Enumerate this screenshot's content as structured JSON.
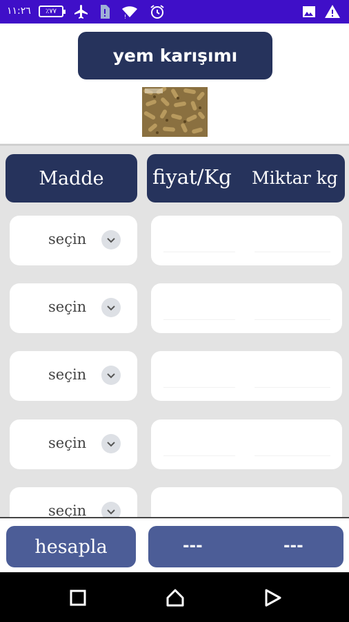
{
  "status_bar": {
    "time": "١١:٢٦",
    "battery": "٪٧٧",
    "icons": [
      "battery-icon",
      "airplane-mode-icon",
      "sim-alert-icon",
      "wifi-icon",
      "alarm-icon",
      "image-notification-icon",
      "warning-icon"
    ]
  },
  "header": {
    "title": "yem karışımı",
    "image_alt": "feed pellets"
  },
  "table": {
    "col_madde": "Madde",
    "col_fiyat": "fiyat/Kg",
    "col_miktar": "Miktar kg",
    "rows": [
      {
        "select": "seçin"
      },
      {
        "select": "seçin"
      },
      {
        "select": "seçin"
      },
      {
        "select": "seçin"
      },
      {
        "select": "seçin"
      }
    ]
  },
  "footer": {
    "calc_label": "hesapla",
    "result_price": "---",
    "result_amount": "---"
  },
  "colors": {
    "status_bar": "#3f0fc8",
    "header_button": "#26335c",
    "footer_button": "#4c5d97",
    "content_bg": "#e3e3e3"
  }
}
